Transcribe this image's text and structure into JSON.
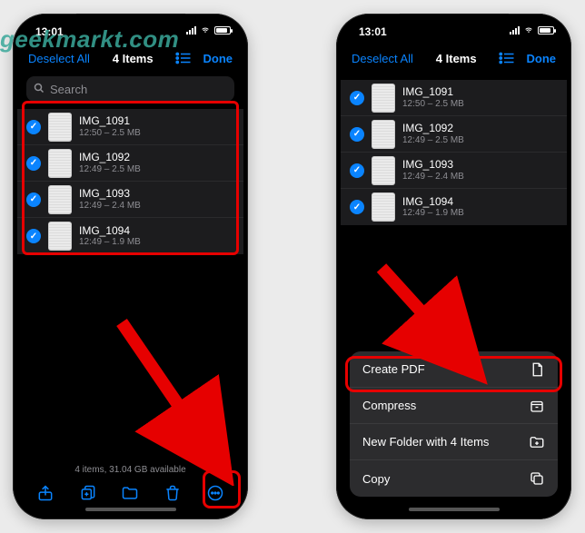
{
  "watermark": "geekmarkt.com",
  "status": {
    "time": "13:01"
  },
  "nav": {
    "deselect": "Deselect All",
    "title": "4 Items",
    "done": "Done"
  },
  "search": {
    "placeholder": "Search"
  },
  "files": [
    {
      "name": "IMG_1091",
      "sub": "12:50 – 2.5 MB"
    },
    {
      "name": "IMG_1092",
      "sub": "12:49 – 2.5 MB"
    },
    {
      "name": "IMG_1093",
      "sub": "12:49 – 2.4 MB"
    },
    {
      "name": "IMG_1094",
      "sub": "12:49 – 1.9 MB"
    }
  ],
  "footer": {
    "status": "4 items, 31.04 GB available"
  },
  "menu": {
    "createPdf": "Create PDF",
    "compress": "Compress",
    "newFolder": "New Folder with 4 Items",
    "copy": "Copy"
  }
}
